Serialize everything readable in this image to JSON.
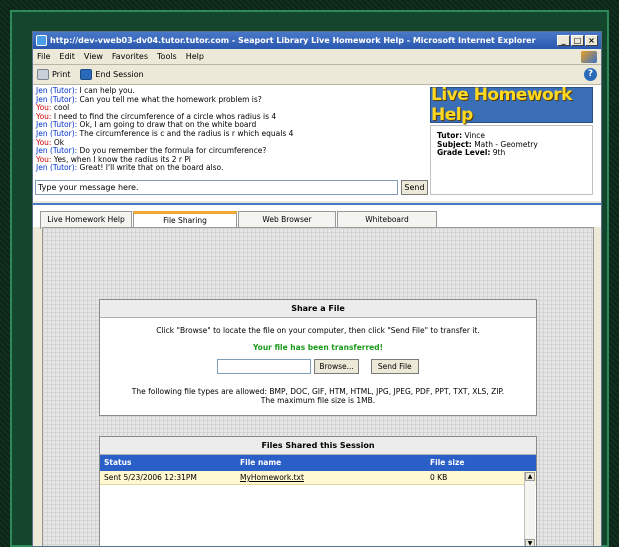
{
  "window": {
    "title": "http://dev-vweb03-dv04.tutor.tutor.com - Seaport Library Live Homework Help - Microsoft Internet Explorer",
    "min_label": "_",
    "max_label": "□",
    "close_label": "×"
  },
  "menu": [
    {
      "label": "File"
    },
    {
      "label": "Edit"
    },
    {
      "label": "View"
    },
    {
      "label": "Favorites"
    },
    {
      "label": "Tools"
    },
    {
      "label": "Help"
    }
  ],
  "toolbar": {
    "print_label": "Print",
    "end_session_label": "End Session",
    "help_glyph": "?"
  },
  "chat": {
    "messages": [
      {
        "who": "Jen (Tutor):",
        "role": "tutor",
        "text": " I can help you."
      },
      {
        "who": "Jen (Tutor):",
        "role": "tutor",
        "text": " Can you tell me what the homework problem is?"
      },
      {
        "who": "You:",
        "role": "you",
        "text": " cool"
      },
      {
        "who": "You:",
        "role": "you",
        "text": " I need to find the circumference of a circle whos radius is 4"
      },
      {
        "who": "Jen (Tutor):",
        "role": "tutor",
        "text": " Ok, I am going to draw that on the white board"
      },
      {
        "who": "Jen (Tutor):",
        "role": "tutor",
        "text": " The circumference is c and the radius is r which equals 4"
      },
      {
        "who": "You:",
        "role": "you",
        "text": " Ok"
      },
      {
        "who": "Jen (Tutor):",
        "role": "tutor",
        "text": " Do you remember the formula for circumference?"
      },
      {
        "who": "You:",
        "role": "you",
        "text": " Yes, when I know the radius its 2 r Pi"
      },
      {
        "who": "Jen (Tutor):",
        "role": "tutor",
        "text": " Great! I'll write that on the board also."
      }
    ],
    "input_value": "Type your message here.",
    "send_label": "Send"
  },
  "brand": {
    "logo_text": "Live Homework Help"
  },
  "tutor_info": {
    "tutor_label": "Tutor:",
    "tutor_value": " Vince",
    "subject_label": "Subject:",
    "subject_value": " Math - Geometry",
    "grade_label": "Grade Level:",
    "grade_value": " 9th"
  },
  "tabs": [
    {
      "label": "Live Homework Help",
      "active": false
    },
    {
      "label": "File Sharing",
      "active": true
    },
    {
      "label": "Web Browser",
      "active": false
    },
    {
      "label": "Whiteboard",
      "active": false
    }
  ],
  "share": {
    "title": "Share a File",
    "instructions": "Click \"Browse\" to locate the file on your computer, then click \"Send File\" to transfer it.",
    "success": "Your file has been transferred!",
    "file_value": "",
    "browse_label": "Browse...",
    "send_file_label": "Send File",
    "types_line1": "The following file types are allowed: BMP, DOC, GIF, HTM, HTML, JPG, JPEG, PDF, PPT, TXT, XLS, ZIP.",
    "types_line2": "The maximum file size is 1MB."
  },
  "files": {
    "title": "Files Shared this Session",
    "columns": [
      "Status",
      "File name",
      "File size"
    ],
    "rows": [
      {
        "status": "Sent 5/23/2006 12:31PM",
        "name": "MyHomework.txt",
        "size": "0 KB"
      }
    ]
  }
}
